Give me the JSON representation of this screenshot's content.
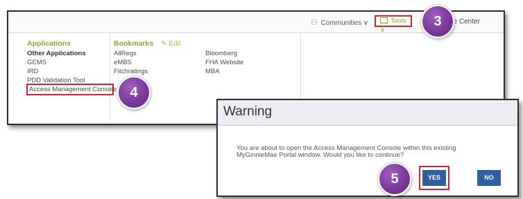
{
  "topbar": {
    "communities_label": "Communities ∨",
    "tools_label": "Tools ∨",
    "knowledge_label": "ge Center"
  },
  "applications": {
    "heading": "Applications",
    "items": [
      "Other Applications",
      "GEMS",
      "IRD",
      "PDD Validation Tool",
      "Access Management Console"
    ]
  },
  "bookmarks": {
    "heading": "Bookmarks",
    "edit_label": "Edit",
    "col1": [
      "AllRegs",
      "eMBS",
      "Fitchratings"
    ],
    "col2": [
      "Bloomberg",
      "FHA Website",
      "MBA"
    ]
  },
  "callouts": {
    "three": "3",
    "four": "4",
    "five": "5"
  },
  "dialog": {
    "title": "Warning",
    "message_line1": "You are about to open the Access Management Console within this existing",
    "message_line2": "MyGinnieMae Portal window. Would you like to continue?",
    "yes_label": "YES",
    "no_label": "NO"
  },
  "colors": {
    "accent_green": "#8aa62a",
    "highlight_red": "#d32030",
    "callout_purple": "#7b3a9c",
    "button_blue": "#2f5f9e"
  },
  "icons": {
    "communities": "people-icon",
    "tools": "box-icon",
    "edit": "pencil-icon"
  }
}
